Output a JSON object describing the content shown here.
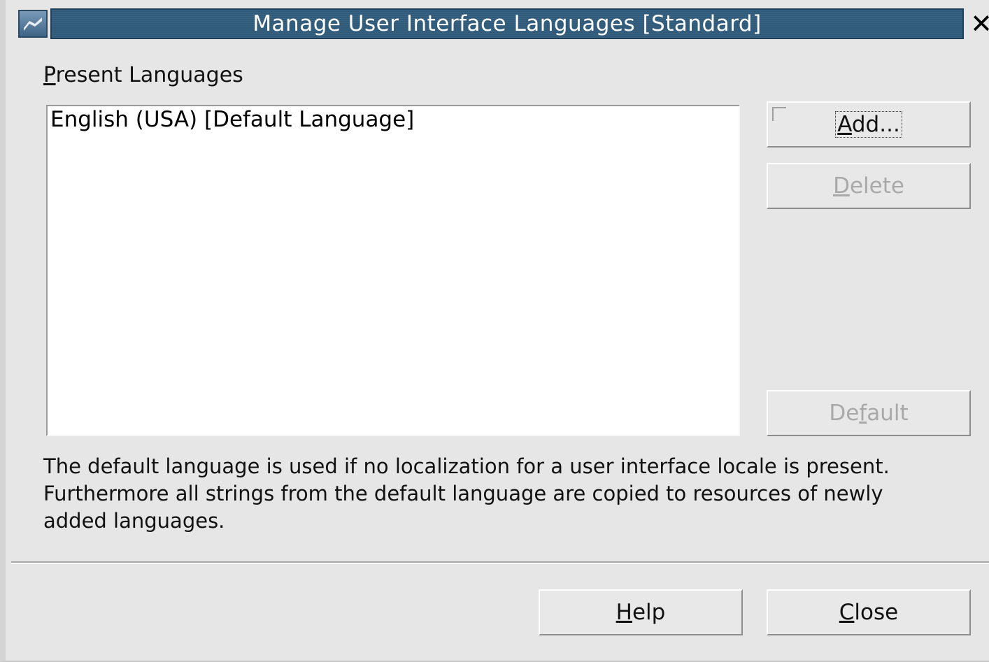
{
  "window": {
    "title": "Manage User Interface Languages [Standard]",
    "close_glyph": "✕",
    "icon": "app-icon"
  },
  "present_languages": {
    "label_accel": "P",
    "label_rest": "resent Languages",
    "items": [
      "English (USA) [Default Language]"
    ]
  },
  "buttons": {
    "add_accel": "A",
    "add_rest": "dd...",
    "delete_accel": "D",
    "delete_rest": "elete",
    "default_pre": "De",
    "default_accel": "f",
    "default_post": "ault",
    "help_accel": "H",
    "help_rest": "elp",
    "close_accel": "C",
    "close_rest": "lose"
  },
  "info_text": "The default language is used if no localization for a user interface locale is present. Furthermore all strings from the default language are copied to resources of newly added languages.",
  "colors": {
    "title_bar": "#2f5a7a",
    "background": "#e6e6e6",
    "disabled_text": "#a9a9a9"
  }
}
